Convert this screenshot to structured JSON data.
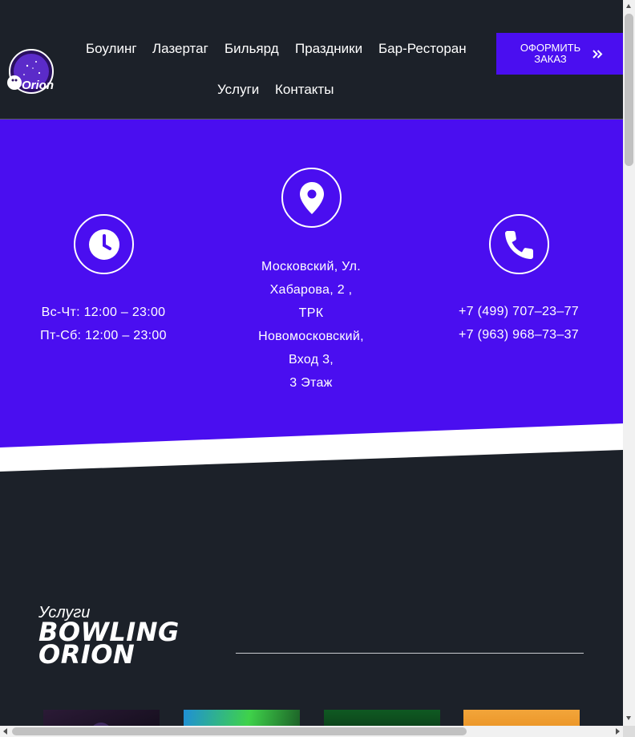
{
  "header": {
    "logo_text": "Orion",
    "nav": [
      "Боулинг",
      "Лазертаг",
      "Бильярд",
      "Праздники",
      "Бар-Ресторан",
      "Услуги",
      "Контакты"
    ],
    "order_button": "ОФОРМИТЬ ЗАКАЗ"
  },
  "contacts": {
    "hours": {
      "icon": "clock-icon",
      "lines": [
        "Вс-Чт: 12:00 – 23:00",
        "Пт-Сб: 12:00 – 23:00"
      ]
    },
    "address": {
      "icon": "map-pin-icon",
      "lines": [
        "Московский, Ул.",
        "Хабарова, 2 ,",
        "ТРК",
        "Новомосковский,",
        "Вход 3,",
        "3 Этаж"
      ]
    },
    "phones": {
      "icon": "phone-icon",
      "lines": [
        "+7 (499) 707–23–77",
        "+7 (963) 968–73–37"
      ]
    }
  },
  "services": {
    "kicker": "Услуги",
    "title_line1": "BOWLING",
    "title_line2": "ORION"
  },
  "colors": {
    "background": "#1c2129",
    "accent": "#4a0ef0",
    "text": "#ffffff"
  }
}
